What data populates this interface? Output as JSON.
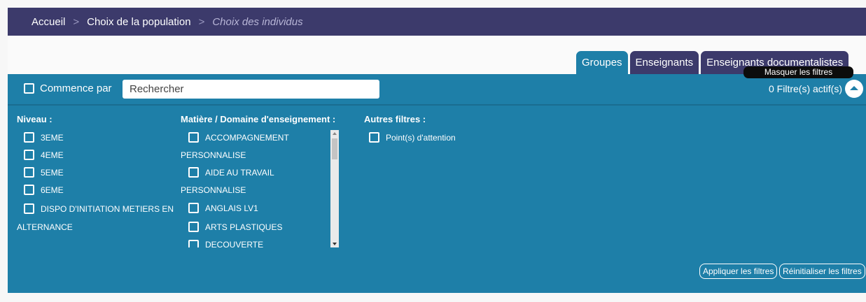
{
  "breadcrumb": {
    "items": [
      "Accueil",
      "Choix de la population"
    ],
    "current": "Choix des individus",
    "separator": ">"
  },
  "tabs": [
    {
      "label": "Groupes",
      "active": true
    },
    {
      "label": "Enseignants",
      "active": false
    },
    {
      "label": "Enseignants documentalistes",
      "active": false
    }
  ],
  "tooltip": "Masquer les filtres",
  "search": {
    "commence_label": "Commence par",
    "placeholder": "Rechercher",
    "active_filters": "0 Filtre(s) actif(s)"
  },
  "filters": {
    "niveau": {
      "title": "Niveau :",
      "options": [
        "3EME",
        "4EME",
        "5EME",
        "6EME",
        "DISPO D'INITIATION METIERS EN",
        "ALTERNANCE"
      ]
    },
    "matiere": {
      "title": "Matière / Domaine d'enseignement :",
      "options": [
        "ACCOMPAGNEMENT",
        "PERSONNALISE",
        "AIDE AU TRAVAIL",
        "PERSONNALISE",
        "ANGLAIS LV1",
        "ARTS PLASTIQUES",
        "DECOUVERTE"
      ]
    },
    "autres": {
      "title": "Autres filtres :",
      "options": [
        "Point(s) d'attention"
      ]
    }
  },
  "buttons": {
    "apply": "Appliquer les filtres",
    "reset": "Réinitialiser les filtres"
  },
  "colors": {
    "header": "#3c3a6b",
    "panel": "#1e7fa8"
  }
}
